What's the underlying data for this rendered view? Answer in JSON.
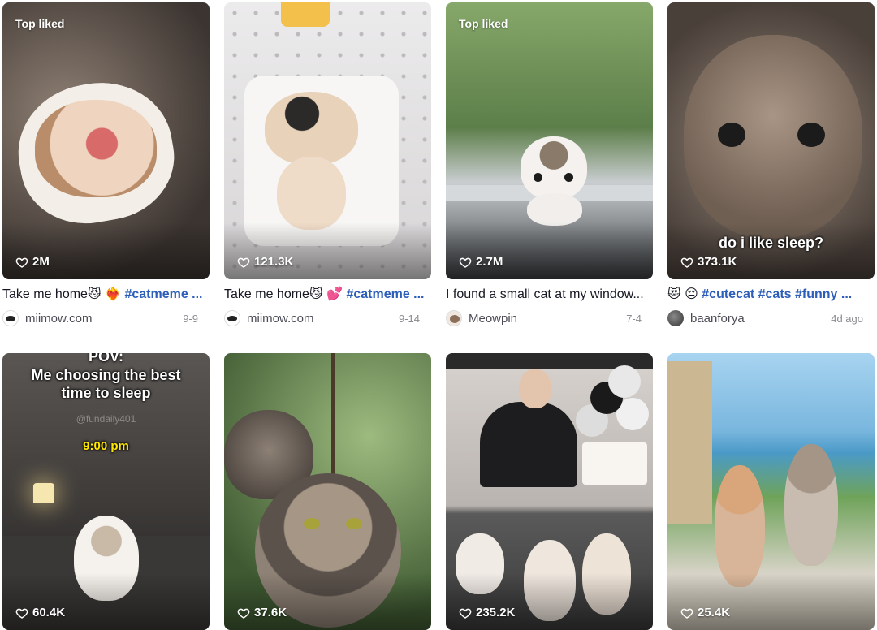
{
  "videos": [
    {
      "badge": "Top liked",
      "likes": "2M",
      "title_text": "Take me home😼 ❤️‍🔥",
      "title_tags": "#catmeme ...",
      "author": "miimow.com",
      "date": "9-9",
      "colors": {
        "bg1": "#6b5e55",
        "bg2": "#3b3430"
      }
    },
    {
      "badge": "",
      "likes": "121.3K",
      "title_text": "Take me home😼 💕",
      "title_tags": "#catmeme ...",
      "author": "miimow.com",
      "date": "9-14",
      "colors": {
        "bg1": "#e9e7e8",
        "bg2": "#c9c6c8"
      }
    },
    {
      "badge": "Top liked",
      "likes": "2.7M",
      "title_text": "I found a small cat at my window...",
      "title_tags": "",
      "author": "Meowpin",
      "date": "7-4",
      "colors": {
        "bg1": "#7f9c63",
        "bg2": "#2f3a2a"
      }
    },
    {
      "badge": "",
      "likes": "373.1K",
      "overlay": "do i like sleep?",
      "title_text": "😻 😔",
      "title_tags": "#cutecat #cats #funny ...",
      "author": "baanforya",
      "date": "4d ago",
      "colors": {
        "bg1": "#8c7e72",
        "bg2": "#4a403a"
      }
    },
    {
      "badge": "",
      "likes": "60.4K",
      "overlay_top": "POV:",
      "overlay_main": "Me choosing the best time to sleep",
      "overlay_watermark": "@fundaily401",
      "overlay_time": "9:00 pm",
      "colors": {
        "bg1": "#4d4a47",
        "bg2": "#1f1d1c"
      }
    },
    {
      "badge": "",
      "likes": "37.6K",
      "colors": {
        "bg1": "#6f8f55",
        "bg2": "#2f3b28"
      }
    },
    {
      "badge": "",
      "likes": "235.2K",
      "colors": {
        "bg1": "#c9c5c2",
        "bg2": "#3a3a3a"
      }
    },
    {
      "badge": "",
      "likes": "25.4K",
      "colors": {
        "bg1": "#8cc3e6",
        "bg2": "#5e8f4a"
      }
    }
  ]
}
